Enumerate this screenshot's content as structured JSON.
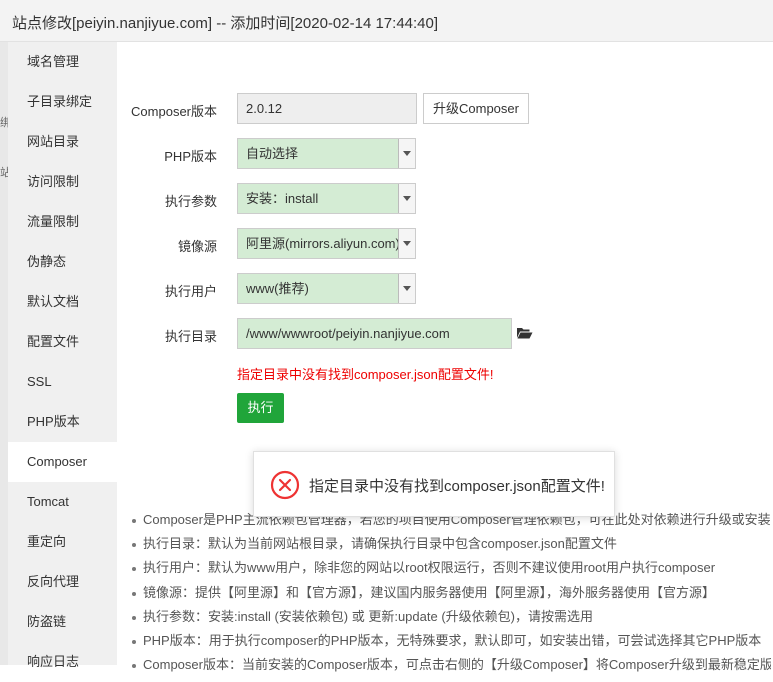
{
  "window": {
    "title": "站点修改[peiyin.nanjiyue.com] -- 添加时间[2020-02-14 17:44:40]"
  },
  "leftedge": [
    "绑",
    "站"
  ],
  "sidebar": {
    "items": [
      {
        "label": "域名管理"
      },
      {
        "label": "子目录绑定"
      },
      {
        "label": "网站目录"
      },
      {
        "label": "访问限制"
      },
      {
        "label": "流量限制"
      },
      {
        "label": "伪静态"
      },
      {
        "label": "默认文档"
      },
      {
        "label": "配置文件"
      },
      {
        "label": "SSL"
      },
      {
        "label": "PHP版本"
      },
      {
        "label": "Composer"
      },
      {
        "label": "Tomcat"
      },
      {
        "label": "重定向"
      },
      {
        "label": "反向代理"
      },
      {
        "label": "防盗链"
      },
      {
        "label": "响应日志"
      }
    ],
    "active": "Composer"
  },
  "form": {
    "composer_version": {
      "label": "Composer版本",
      "value": "2.0.12"
    },
    "upgrade_button": "升级Composer",
    "php_version": {
      "label": "PHP版本",
      "value": "自动选择"
    },
    "exec_params": {
      "label": "执行参数",
      "value": "安装：install"
    },
    "mirror": {
      "label": "镜像源",
      "value": "阿里源(mirrors.aliyun.com)"
    },
    "exec_user": {
      "label": "执行用户",
      "value": "www(推荐)"
    },
    "exec_dir": {
      "label": "执行目录",
      "value": "/www/wwwroot/peiyin.nanjiyue.com"
    },
    "error": "指定目录中没有找到composer.json配置文件!",
    "exec_button": "执行"
  },
  "tips": [
    "Composer是PHP主流依赖包管理器，若您的项目使用Composer管理依赖包，可在此处对依赖进行升级或安装",
    "执行目录：默认为当前网站根目录，请确保执行目录中包含composer.json配置文件",
    "执行用户：默认为www用户，除非您的网站以root权限运行，否则不建议使用root用户执行composer",
    "镜像源：提供【阿里源】和【官方源】，建议国内服务器使用【阿里源】，海外服务器使用【官方源】",
    "执行参数：安装:install (安装依赖包) 或 更新:update (升级依赖包)，请按需选用",
    "PHP版本：用于执行composer的PHP版本，无特殊要求，默认即可，如安装出错，可尝试选择其它PHP版本",
    "Composer版本：当前安装的Composer版本，可点击右侧的【升级Composer】将Composer升级到最新稳定版"
  ],
  "toast": {
    "message": "指定目录中没有找到composer.json配置文件!"
  },
  "colors": {
    "accent": "#20a53a",
    "error": "#ee0000",
    "field_bg": "#d4ecd4"
  },
  "icons": {
    "folder": "folder-open-icon",
    "toast": "error-circle-icon"
  }
}
